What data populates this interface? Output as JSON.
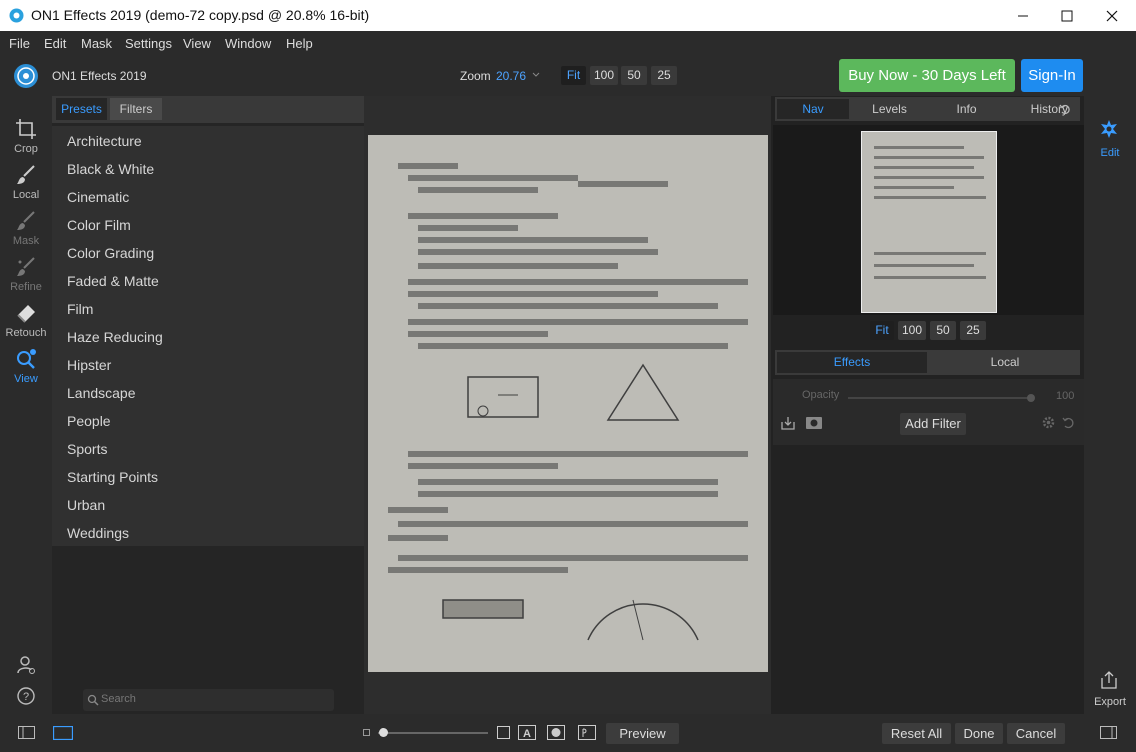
{
  "window": {
    "title": "ON1 Effects 2019 (demo-72 copy.psd @ 20.8% 16-bit)"
  },
  "menu": [
    "File",
    "Edit",
    "Mask",
    "Settings",
    "View",
    "Window",
    "Help"
  ],
  "header": {
    "app_name": "ON1 Effects 2019",
    "zoom_label": "Zoom",
    "zoom_value": "20.76",
    "zoom_buttons": [
      "Fit",
      "100",
      "50",
      "25"
    ],
    "buy_label": "Buy Now - 30 Days Left",
    "signin_label": "Sign-In"
  },
  "tools": [
    "Crop",
    "Local",
    "Mask",
    "Refine",
    "Retouch",
    "View"
  ],
  "presets": {
    "tabs": [
      "Presets",
      "Filters"
    ],
    "items": [
      "Architecture",
      "Black & White",
      "Cinematic",
      "Color Film",
      "Color Grading",
      "Faded & Matte",
      "Film",
      "Haze Reducing",
      "Hipster",
      "Landscape",
      "People",
      "Sports",
      "Starting Points",
      "Urban",
      "Weddings"
    ],
    "search_placeholder": "Search"
  },
  "nav": {
    "tabs": [
      "Nav",
      "Levels",
      "Info",
      "History"
    ],
    "zoom_buttons": [
      "Fit",
      "100",
      "50",
      "25"
    ]
  },
  "effects": {
    "tabs": [
      "Effects",
      "Local"
    ],
    "opacity_label": "Opacity",
    "opacity_value": "100",
    "add_filter_label": "Add Filter"
  },
  "right_strip": {
    "edit_label": "Edit",
    "export_label": "Export"
  },
  "bottom": {
    "preview_label": "Preview",
    "reset_label": "Reset All",
    "done_label": "Done",
    "cancel_label": "Cancel"
  },
  "colors": {
    "accent": "#3a9cff",
    "buy": "#5cb85c",
    "signin": "#1e8cf0"
  }
}
